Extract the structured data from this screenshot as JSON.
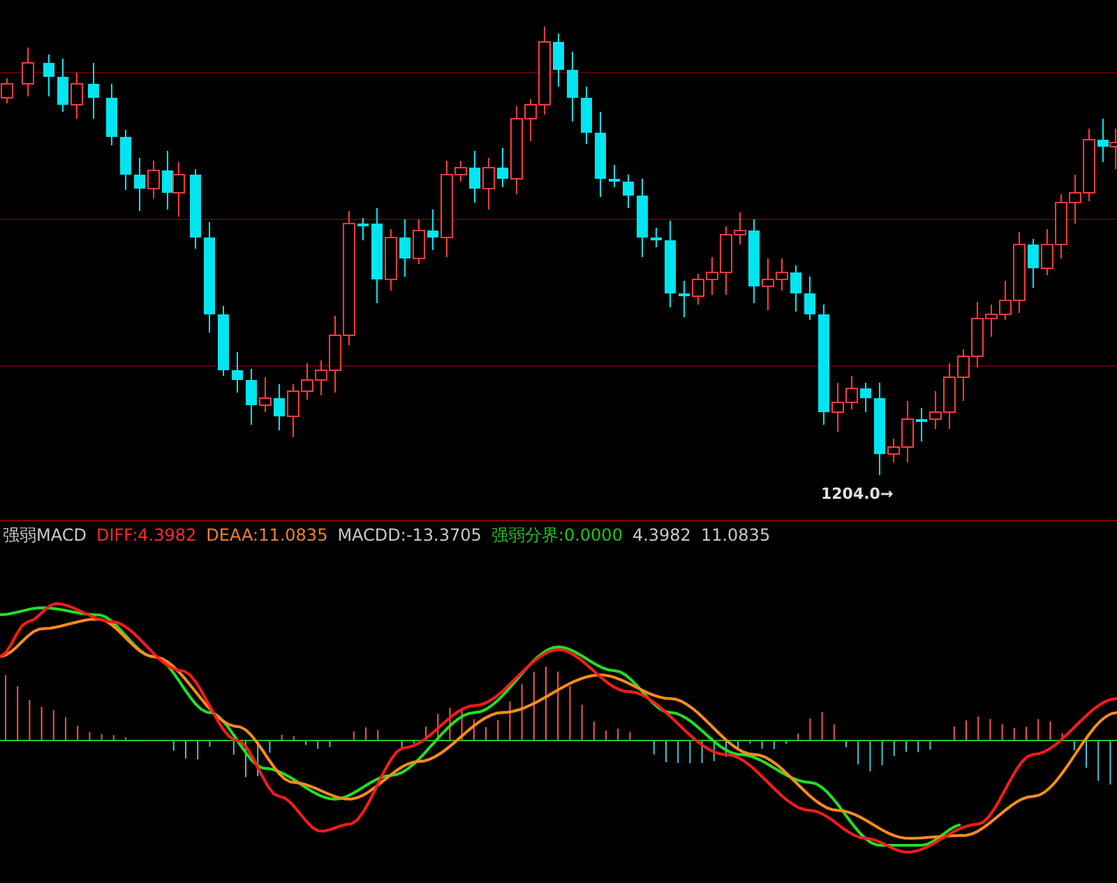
{
  "price_chart": {
    "low_label": "1204.0→"
  },
  "indicator": {
    "items": [
      {
        "text": "强弱MACD",
        "color": "#c8c8c8"
      },
      {
        "text": "DIFF:4.3982",
        "color": "#ff2a2a"
      },
      {
        "text": "DEAA:11.0835",
        "color": "#e8832c"
      },
      {
        "text": "MACDD:-13.3705",
        "color": "#c8c8c8"
      },
      {
        "text": "强弱分界:0.0000",
        "color": "#19c819"
      },
      {
        "text": "4.3982",
        "color": "#c8c8c8"
      },
      {
        "text": "11.0835",
        "color": "#c8c8c8"
      }
    ]
  }
}
